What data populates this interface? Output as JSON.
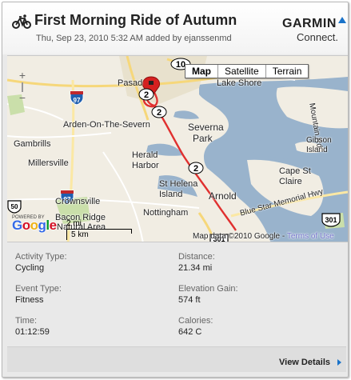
{
  "activity": {
    "title": "First Morning Ride of Autumn",
    "subtitle": "Thu, Sep 23, 2010 5:32 AM added by ejanssenmd"
  },
  "brand": {
    "name": "GARMIN",
    "product": "Connect.",
    "accent": "#1a73c9"
  },
  "map": {
    "type_buttons": [
      "Map",
      "Satellite",
      "Terrain"
    ],
    "active_type": "Map",
    "zoom_in": "+",
    "zoom_out": "−",
    "google_letters": [
      "G",
      "o",
      "o",
      "g",
      "l",
      "e"
    ],
    "powered_by": "POWERED BY",
    "scale_km": "5 km",
    "scale_mi": "2 mi",
    "copyright": "Map data ©2010 Google -",
    "terms": "Terms of Use",
    "route_color": "#e0302f",
    "labels": {
      "pasadena": "Pasad",
      "lake_shore": "Lake Shore",
      "mountain_rd": "Mountain Rd",
      "arden": "Arden-On-The-Severn",
      "severna": "Severna",
      "park": "Park",
      "gambrills": "Gambrills",
      "herald": "Herald",
      "harbor": "Harbor",
      "gibson": "Gibson",
      "island": "Island",
      "millersville": "Millersville",
      "cape_st": "Cape St",
      "claire": "Claire",
      "st_helena": "St Helena",
      "st_helena_island": "Island",
      "arnold": "Arnold",
      "crownsville": "Crownsville",
      "nottingham": "Nottingham",
      "bacon_ridge": "Bacon Ridge",
      "natural_area": "Natural Area",
      "blue_star": "Blue Star Memorial Hwy"
    },
    "shields": {
      "r10": "10",
      "r2a": "2",
      "r2b": "2",
      "r2c": "2",
      "r97a": "97",
      "r97b": "97",
      "r301a": "301",
      "r301b": "301",
      "r50": "50"
    }
  },
  "stats": {
    "activity_type_label": "Activity Type:",
    "activity_type": "Cycling",
    "event_type_label": "Event Type:",
    "event_type": "Fitness",
    "time_label": "Time:",
    "time": "01:12:59",
    "distance_label": "Distance:",
    "distance": "21.34 mi",
    "elevation_label": "Elevation Gain:",
    "elevation": "574 ft",
    "calories_label": "Calories:",
    "calories": "642 C"
  },
  "footer": {
    "view_details": "View Details"
  }
}
